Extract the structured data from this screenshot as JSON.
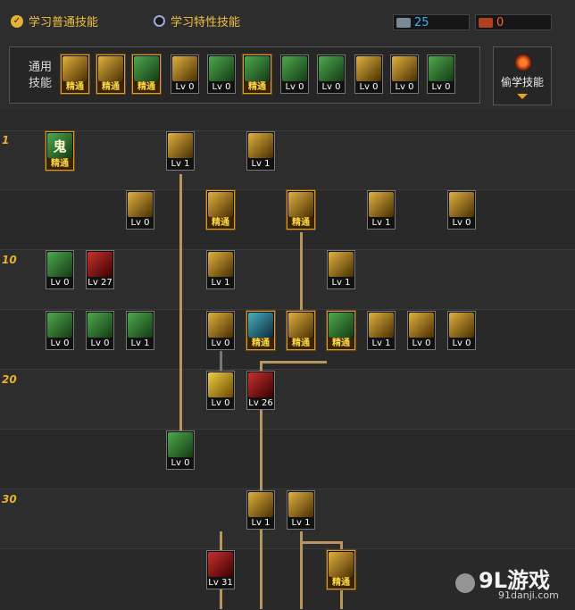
{
  "tabs": [
    {
      "label": "学习普通技能",
      "selected": true
    },
    {
      "label": "学习特性技能",
      "selected": false
    }
  ],
  "resources": [
    {
      "icon": "sp-book-icon",
      "value": "25",
      "color": "#3ab0ff"
    },
    {
      "icon": "tp-book-icon",
      "value": "0",
      "color": "#ff6040"
    }
  ],
  "common": {
    "label": "通用\n技能",
    "skills": [
      {
        "icon": "skill-icon",
        "label": "精通",
        "tone": "gold"
      },
      {
        "icon": "skill-icon",
        "label": "精通",
        "tone": "gold"
      },
      {
        "icon": "skill-icon",
        "label": "精通",
        "tone": "green"
      },
      {
        "icon": "skill-icon",
        "label": "Lv 0",
        "tone": "gold"
      },
      {
        "icon": "skill-icon",
        "label": "Lv 0",
        "tone": "green"
      },
      {
        "icon": "skill-icon",
        "label": "精通",
        "tone": "green"
      },
      {
        "icon": "skill-icon",
        "label": "Lv 0",
        "tone": "green"
      },
      {
        "icon": "skill-icon",
        "label": "Lv 0",
        "tone": "green"
      },
      {
        "icon": "skill-icon",
        "label": "Lv 0",
        "tone": "gold"
      },
      {
        "icon": "skill-icon",
        "label": "Lv 0",
        "tone": "gold"
      },
      {
        "icon": "skill-icon",
        "label": "Lv 0",
        "tone": "green"
      }
    ]
  },
  "steal": {
    "label": "偷学技能"
  },
  "levels": [
    "1",
    "10",
    "20",
    "30"
  ],
  "rows": [
    [
      {
        "icon": "ghost-skill-icon",
        "glyph": "鬼",
        "label": "精通",
        "tone": "green"
      },
      {
        "icon": "skill-icon",
        "label": "Lv 1",
        "tone": "gold"
      },
      {
        "icon": "skill-icon",
        "label": "Lv 1",
        "tone": "gold"
      }
    ],
    [
      {
        "icon": "skill-icon",
        "label": "Lv 0",
        "tone": "gold"
      },
      {
        "icon": "skill-icon",
        "label": "精通",
        "tone": "gold"
      },
      {
        "icon": "skill-icon",
        "label": "精通",
        "tone": "gold"
      },
      {
        "icon": "skill-icon",
        "label": "Lv 1",
        "tone": "gold"
      },
      {
        "icon": "skill-icon",
        "label": "Lv 0",
        "tone": "gold"
      }
    ],
    [
      {
        "icon": "skill-icon",
        "label": "Lv 0",
        "tone": "green"
      },
      {
        "icon": "skill-icon",
        "label": "Lv 27",
        "tone": "red"
      },
      {
        "icon": "skill-icon",
        "label": "Lv 1",
        "tone": "gold"
      },
      {
        "icon": "skill-icon",
        "label": "Lv 1",
        "tone": "gold"
      }
    ],
    [
      {
        "icon": "skill-icon",
        "label": "Lv 0",
        "tone": "green"
      },
      {
        "icon": "skill-icon",
        "label": "Lv 0",
        "tone": "green"
      },
      {
        "icon": "skill-icon",
        "label": "Lv 1",
        "tone": "green"
      },
      {
        "icon": "skill-icon",
        "label": "Lv 0",
        "tone": "gold"
      },
      {
        "icon": "skill-icon",
        "label": "精通",
        "tone": "blue"
      },
      {
        "icon": "skill-icon",
        "label": "精通",
        "tone": "gold"
      },
      {
        "icon": "skill-icon",
        "label": "精通",
        "tone": "green"
      },
      {
        "icon": "skill-icon",
        "label": "Lv 1",
        "tone": "gold"
      },
      {
        "icon": "skill-icon",
        "label": "Lv 0",
        "tone": "gold"
      },
      {
        "icon": "skill-icon",
        "label": "Lv 0",
        "tone": "gold"
      }
    ],
    [
      {
        "icon": "skill-icon",
        "label": "Lv 0",
        "tone": "yellow"
      },
      {
        "icon": "skill-icon",
        "label": "Lv 26",
        "tone": "red"
      }
    ],
    [
      {
        "icon": "skill-icon",
        "label": "Lv 0",
        "tone": "green"
      }
    ],
    [
      {
        "icon": "skill-icon",
        "label": "Lv 1",
        "tone": "gold"
      },
      {
        "icon": "skill-icon",
        "label": "Lv 1",
        "tone": "gold"
      }
    ],
    [
      {
        "icon": "skill-icon",
        "label": "Lv 31",
        "tone": "red"
      },
      {
        "icon": "skill-icon",
        "label": "精通",
        "tone": "gold"
      }
    ]
  ],
  "watermark": {
    "logo": "9L游戏",
    "url": "91danji.com"
  }
}
